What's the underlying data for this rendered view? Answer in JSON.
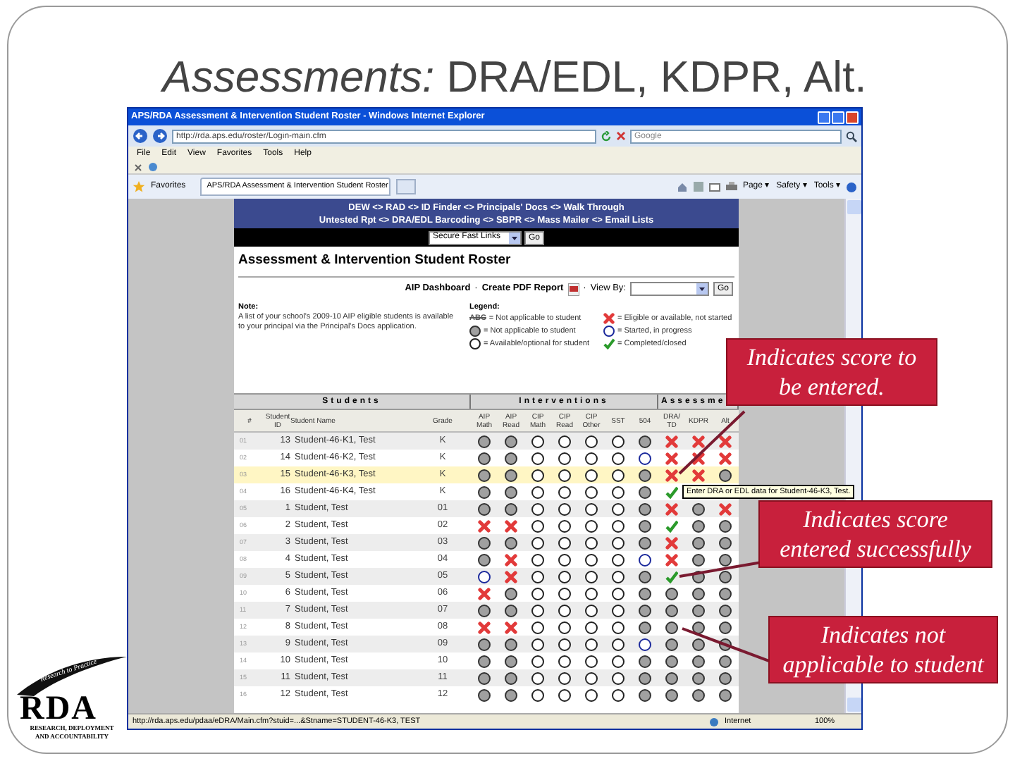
{
  "slide": {
    "title": "*Assessments:* DRA/EDL, KDPR, Alt."
  },
  "browser": {
    "title": "APS/RDA Assessment & Intervention Student Roster - Windows Internet Explorer",
    "address": "http://rda.aps.edu/roster/Login-main.cfm",
    "search_placeholder": "Google",
    "menu": [
      "File",
      "Edit",
      "View",
      "Favorites",
      "Tools",
      "Help"
    ],
    "favorites": "Favorites",
    "tab": "APS/RDA Assessment & Intervention Student Roster",
    "commands": [
      "Page ▾",
      "Safety ▾",
      "Tools ▾"
    ],
    "status_url": "http://rda.aps.edu/pdaa/eDRA/Main.cfm?stuid=...&Stname=STUDENT-46-K3, TEST",
    "zone": "Internet",
    "zoom": "100%"
  },
  "page": {
    "nav": [
      "DEW <> RAD <> ID Finder <> Principals' Docs <> Walk Through",
      "Untested Rpt <> DRA/EDL Barcoding <> SBPR <> Mass Mailer <> Email Lists"
    ],
    "quick_links": {
      "value": "Secure Fast Links",
      "button": "Go"
    },
    "heading": "Assessment & Intervention Student Roster",
    "toolbar": [
      {
        "kind": "link",
        "text": "AIP Dashboard"
      },
      {
        "kind": "sep",
        "text": "·"
      },
      {
        "kind": "report",
        "text": "Create PDF Report"
      },
      {
        "kind": "sep",
        "text": "·"
      },
      {
        "kind": "label",
        "text": "View By:"
      }
    ],
    "view_by_button": "Go",
    "note": {
      "title": "Note:",
      "text": "A list of your school's 2009-10 AIP eligible students is available to your principal via the Principal's Docs application."
    },
    "legend": {
      "title": "Legend:",
      "items": [
        {
          "kind": "strike",
          "sample": "ABC",
          "text": "= Not applicable to student"
        },
        {
          "kind": "na",
          "text": "= Not applicable to student"
        },
        {
          "kind": "available",
          "text": "= Available/optional for student"
        },
        {
          "kind": "not_started",
          "text": "= Eligible or available, not started"
        },
        {
          "kind": "started",
          "text": "= Started, in progress"
        },
        {
          "kind": "completed",
          "text": "= Completed/closed"
        }
      ]
    },
    "groups": [
      "Students",
      "Interventions",
      "Assessme"
    ],
    "columns": [
      "#",
      "Student ID",
      "Student Name",
      "Grade",
      "AIP Math",
      "AIP Read",
      "CIP Math",
      "CIP Read",
      "CIP Other",
      "SST",
      "504",
      "DRA/ TD",
      "KDPR",
      "Alt"
    ],
    "rows": [
      {
        "n": "01",
        "id": "13",
        "name": "Student-46-K1, Test",
        "grade": "K",
        "selected": false,
        "cells": [
          {
            "kind": "na"
          },
          {
            "kind": "na"
          },
          {
            "kind": "available"
          },
          {
            "kind": "available"
          },
          {
            "kind": "available"
          },
          {
            "kind": "available"
          },
          {
            "kind": "na"
          },
          {
            "kind": "not_started"
          },
          {
            "kind": "not_started"
          },
          {
            "kind": "not_started"
          }
        ]
      },
      {
        "n": "02",
        "id": "14",
        "name": "Student-46-K2, Test",
        "grade": "K",
        "selected": false,
        "cells": [
          {
            "kind": "na"
          },
          {
            "kind": "na"
          },
          {
            "kind": "available"
          },
          {
            "kind": "available"
          },
          {
            "kind": "available"
          },
          {
            "kind": "available"
          },
          {
            "kind": "started"
          },
          {
            "kind": "not_started"
          },
          {
            "kind": "not_started"
          },
          {
            "kind": "not_started"
          }
        ]
      },
      {
        "n": "03",
        "id": "15",
        "name": "Student-46-K3, Test",
        "grade": "K",
        "selected": true,
        "cells": [
          {
            "kind": "na"
          },
          {
            "kind": "na"
          },
          {
            "kind": "available"
          },
          {
            "kind": "available"
          },
          {
            "kind": "available"
          },
          {
            "kind": "available"
          },
          {
            "kind": "na"
          },
          {
            "kind": "not_started"
          },
          {
            "kind": "not_started"
          },
          {
            "kind": "na"
          }
        ]
      },
      {
        "n": "04",
        "id": "16",
        "name": "Student-46-K4, Test",
        "grade": "K",
        "selected": false,
        "cells": [
          {
            "kind": "na"
          },
          {
            "kind": "na"
          },
          {
            "kind": "available"
          },
          {
            "kind": "available"
          },
          {
            "kind": "available"
          },
          {
            "kind": "available"
          },
          {
            "kind": "na"
          },
          {
            "kind": "completed"
          }
        ]
      },
      {
        "n": "05",
        "id": "1",
        "name": "Student, Test",
        "grade": "01",
        "selected": false,
        "cells": [
          {
            "kind": "na"
          },
          {
            "kind": "na"
          },
          {
            "kind": "available"
          },
          {
            "kind": "available"
          },
          {
            "kind": "available"
          },
          {
            "kind": "available"
          },
          {
            "kind": "na"
          },
          {
            "kind": "not_started"
          },
          {
            "kind": "na"
          },
          {
            "kind": "not_started"
          }
        ]
      },
      {
        "n": "06",
        "id": "2",
        "name": "Student, Test",
        "grade": "02",
        "selected": false,
        "cells": [
          {
            "kind": "not_started"
          },
          {
            "kind": "not_started"
          },
          {
            "kind": "available"
          },
          {
            "kind": "available"
          },
          {
            "kind": "available"
          },
          {
            "kind": "available"
          },
          {
            "kind": "na"
          },
          {
            "kind": "completed"
          },
          {
            "kind": "na"
          },
          {
            "kind": "na"
          }
        ]
      },
      {
        "n": "07",
        "id": "3",
        "name": "Student, Test",
        "grade": "03",
        "selected": false,
        "cells": [
          {
            "kind": "na"
          },
          {
            "kind": "na"
          },
          {
            "kind": "available"
          },
          {
            "kind": "available"
          },
          {
            "kind": "available"
          },
          {
            "kind": "available"
          },
          {
            "kind": "na"
          },
          {
            "kind": "not_started"
          },
          {
            "kind": "na"
          },
          {
            "kind": "na"
          }
        ]
      },
      {
        "n": "08",
        "id": "4",
        "name": "Student, Test",
        "grade": "04",
        "selected": false,
        "cells": [
          {
            "kind": "na"
          },
          {
            "kind": "not_started"
          },
          {
            "kind": "available"
          },
          {
            "kind": "available"
          },
          {
            "kind": "available"
          },
          {
            "kind": "available"
          },
          {
            "kind": "started"
          },
          {
            "kind": "not_started"
          },
          {
            "kind": "na"
          },
          {
            "kind": "na"
          }
        ]
      },
      {
        "n": "09",
        "id": "5",
        "name": "Student, Test",
        "grade": "05",
        "selected": false,
        "cells": [
          {
            "kind": "started"
          },
          {
            "kind": "not_started"
          },
          {
            "kind": "available"
          },
          {
            "kind": "available"
          },
          {
            "kind": "available"
          },
          {
            "kind": "available"
          },
          {
            "kind": "na"
          },
          {
            "kind": "completed"
          },
          {
            "kind": "na"
          },
          {
            "kind": "na"
          }
        ]
      },
      {
        "n": "10",
        "id": "6",
        "name": "Student, Test",
        "grade": "06",
        "selected": false,
        "cells": [
          {
            "kind": "not_started"
          },
          {
            "kind": "na"
          },
          {
            "kind": "available"
          },
          {
            "kind": "available"
          },
          {
            "kind": "available"
          },
          {
            "kind": "available"
          },
          {
            "kind": "na"
          },
          {
            "kind": "na"
          },
          {
            "kind": "na"
          },
          {
            "kind": "na"
          }
        ]
      },
      {
        "n": "11",
        "id": "7",
        "name": "Student, Test",
        "grade": "07",
        "selected": false,
        "cells": [
          {
            "kind": "na"
          },
          {
            "kind": "na"
          },
          {
            "kind": "available"
          },
          {
            "kind": "available"
          },
          {
            "kind": "available"
          },
          {
            "kind": "available"
          },
          {
            "kind": "na"
          },
          {
            "kind": "na"
          },
          {
            "kind": "na"
          },
          {
            "kind": "na"
          }
        ]
      },
      {
        "n": "12",
        "id": "8",
        "name": "Student, Test",
        "grade": "08",
        "selected": false,
        "cells": [
          {
            "kind": "not_started"
          },
          {
            "kind": "not_started"
          },
          {
            "kind": "available"
          },
          {
            "kind": "available"
          },
          {
            "kind": "available"
          },
          {
            "kind": "available"
          },
          {
            "kind": "na"
          },
          {
            "kind": "na"
          },
          {
            "kind": "na"
          },
          {
            "kind": "na"
          }
        ]
      },
      {
        "n": "13",
        "id": "9",
        "name": "Student, Test",
        "grade": "09",
        "selected": false,
        "cells": [
          {
            "kind": "na"
          },
          {
            "kind": "na"
          },
          {
            "kind": "available"
          },
          {
            "kind": "available"
          },
          {
            "kind": "available"
          },
          {
            "kind": "available"
          },
          {
            "kind": "started"
          },
          {
            "kind": "na"
          },
          {
            "kind": "na"
          },
          {
            "kind": "na"
          }
        ]
      },
      {
        "n": "14",
        "id": "10",
        "name": "Student, Test",
        "grade": "10",
        "selected": false,
        "cells": [
          {
            "kind": "na"
          },
          {
            "kind": "na"
          },
          {
            "kind": "available"
          },
          {
            "kind": "available"
          },
          {
            "kind": "available"
          },
          {
            "kind": "available"
          },
          {
            "kind": "na"
          },
          {
            "kind": "na"
          },
          {
            "kind": "na"
          },
          {
            "kind": "na"
          }
        ]
      },
      {
        "n": "15",
        "id": "11",
        "name": "Student, Test",
        "grade": "11",
        "selected": false,
        "cells": [
          {
            "kind": "na"
          },
          {
            "kind": "na"
          },
          {
            "kind": "available"
          },
          {
            "kind": "available"
          },
          {
            "kind": "available"
          },
          {
            "kind": "available"
          },
          {
            "kind": "na"
          },
          {
            "kind": "na"
          },
          {
            "kind": "na"
          },
          {
            "kind": "na"
          }
        ]
      },
      {
        "n": "16",
        "id": "12",
        "name": "Student, Test",
        "grade": "12",
        "selected": false,
        "cells": [
          {
            "kind": "na"
          },
          {
            "kind": "na"
          },
          {
            "kind": "available"
          },
          {
            "kind": "available"
          },
          {
            "kind": "available"
          },
          {
            "kind": "available"
          },
          {
            "kind": "na"
          },
          {
            "kind": "na"
          },
          {
            "kind": "na"
          },
          {
            "kind": "na"
          }
        ]
      }
    ],
    "tooltip": "Enter DRA or EDL data for Student-46-K3, Test."
  },
  "callouts": [
    "Indicates score to be entered.",
    "Indicates score entered successfully",
    "Indicates not applicable to student"
  ],
  "logo": {
    "slogan": "Research to Practice",
    "mark": "RDA",
    "lines": [
      "RESEARCH, DEPLOYMENT",
      "AND ACCOUNTABILITY"
    ]
  }
}
